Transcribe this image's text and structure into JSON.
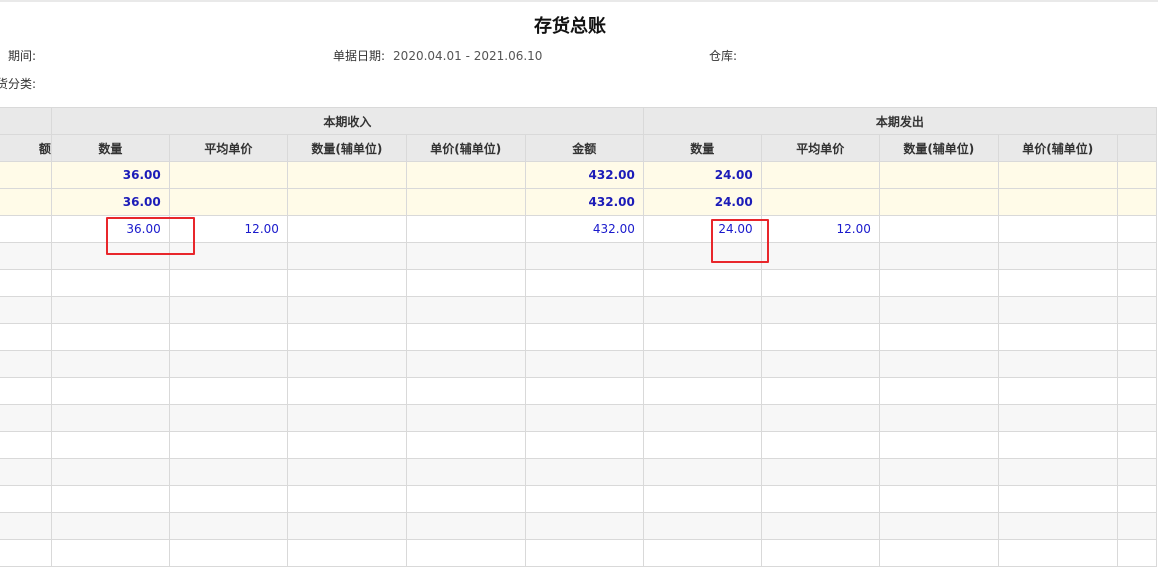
{
  "report": {
    "title": "存货总账"
  },
  "filters": {
    "period_label": "期间:",
    "date_label": "单据日期:",
    "date_value": "2020.04.01 - 2021.06.10",
    "warehouse_label": "仓库:",
    "category_label": "货分类:"
  },
  "table": {
    "first_col_header": "额",
    "groups": {
      "income": "本期收入",
      "outgo": "本期发出"
    },
    "income_columns": [
      "数量",
      "平均单价",
      "数量(辅单位)",
      "单价(辅单位)",
      "金额"
    ],
    "outgo_columns": [
      "数量",
      "平均单价",
      "数量(辅单位)",
      "单价(辅单位)"
    ],
    "rows": [
      {
        "type": "total",
        "cells": [
          "",
          "36.00",
          "",
          "",
          "",
          "432.00",
          "24.00",
          "",
          "",
          "",
          ""
        ]
      },
      {
        "type": "total",
        "cells": [
          "",
          "36.00",
          "",
          "",
          "",
          "432.00",
          "24.00",
          "",
          "",
          "",
          ""
        ]
      },
      {
        "type": "detail",
        "cells": [
          "",
          "36.00",
          "12.00",
          "",
          "",
          "432.00",
          "24.00",
          "12.00",
          "",
          "",
          ""
        ]
      }
    ]
  },
  "colors": {
    "highlight": "#e8262b",
    "total_row_bg": "#fffbe8",
    "value_text": "#1a1acc",
    "header_bg": "#e9e9e9"
  }
}
